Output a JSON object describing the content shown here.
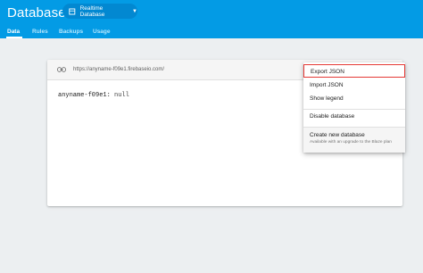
{
  "header": {
    "title": "Database",
    "db_selector": "Realtime Database",
    "tabs": [
      "Data",
      "Rules",
      "Backups",
      "Usage"
    ]
  },
  "card": {
    "url": "https://anyname-f09e1.firebaseio.com/",
    "node_key": "anyname-f09e1",
    "node_sep": ":",
    "node_value": "null"
  },
  "menu": {
    "export": "Export JSON",
    "import": "Import JSON",
    "legend": "Show legend",
    "disable": "Disable database",
    "create": "Create new database",
    "create_note": "Available with an upgrade to the Blaze plan"
  },
  "colors": {
    "header": "#039be5",
    "highlight_border": "#e53935",
    "background": "#eceff1"
  }
}
